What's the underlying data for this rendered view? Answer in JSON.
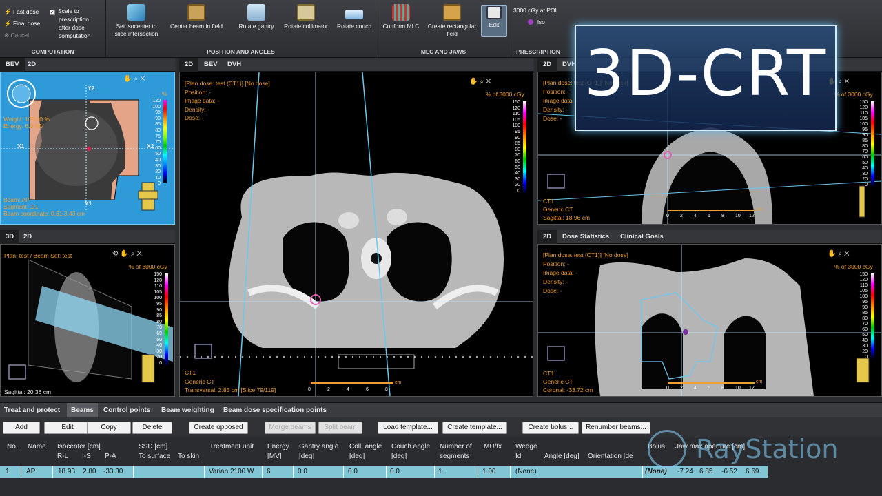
{
  "ribbon": {
    "computation": {
      "fast_dose": "Fast dose",
      "final_dose": "Final dose",
      "cancel": "Cancel",
      "scale_check": "Scale to",
      "scale_l2": "prescription",
      "scale_l3": "after dose",
      "scale_l4": "computation",
      "label": "COMPUTATION"
    },
    "position": {
      "set_iso_l1": "Set isocenter to",
      "set_iso_l2": "slice intersection",
      "center_beam": "Center beam in field",
      "rotate_gantry": "Rotate gantry",
      "rotate_collimator": "Rotate collimator",
      "rotate_couch": "Rotate couch",
      "label": "POSITION AND ANGLES"
    },
    "mlc": {
      "conform": "Conform MLC",
      "create_rect_l1": "Create rectangular",
      "create_rect_l2": "field",
      "edit": "Edit",
      "label": "MLC AND JAWS"
    },
    "prescription": {
      "value": "3000 cGy at POI",
      "iso": "iso",
      "label": "PRESCRIPTION"
    }
  },
  "title_overlay": "3D-CRT",
  "logo": "RayStation",
  "bev": {
    "tabs": [
      "BEV",
      "2D"
    ],
    "weight": "Weight: 100.00 %",
    "energy": "Energy: 6.0 MV",
    "y2": "Y2",
    "y1": "Y1",
    "x1": "X1",
    "x2": "X2",
    "beam": "Beam: AP",
    "segment": "Segment: 1/1",
    "beam_coord": "Beam coordinate: 0.61 3.43 cm",
    "scale_unit": "%",
    "scale": [
      "120",
      "100",
      "95",
      "90",
      "85",
      "80",
      "75",
      "70",
      "60",
      "50",
      "40",
      "30",
      "20",
      "10",
      "0"
    ]
  },
  "view3d": {
    "tabs": [
      "3D",
      "2D"
    ],
    "plan": "Plan: test / Beam Set: test",
    "unit": "% of 3000 cGy",
    "scale": [
      "150",
      "120",
      "110",
      "105",
      "100",
      "95",
      "90",
      "85",
      "80",
      "70",
      "60",
      "50",
      "40",
      "30",
      "20",
      "0"
    ],
    "sagittal": "Sagittal: 20.36 cm"
  },
  "center": {
    "tabs": [
      "2D",
      "BEV",
      "DVH"
    ],
    "plan_dose": "[Plan dose: test (CT1)] [No dose]",
    "position": "Position: -",
    "image_data": "Image data: -",
    "density": "Density: -",
    "dose": "Dose: -",
    "unit": "% of 3000 cGy",
    "scale": [
      "150",
      "120",
      "110",
      "105",
      "100",
      "95",
      "90",
      "85",
      "80",
      "70",
      "60",
      "50",
      "40",
      "30",
      "20",
      "0"
    ],
    "ct": "CT1",
    "generic": "Generic CT",
    "transversal": "Transversal: 2.85 cm [Slice 79/119]",
    "ruler": [
      "0",
      "2",
      "4",
      "6",
      "8"
    ],
    "ruler_unit": "cm"
  },
  "topright": {
    "tabs": [
      "2D",
      "DVH"
    ],
    "plan_dose": "[Plan dose: test (CT1)] [No dose]",
    "position": "Position: -",
    "image_data": "Image data: -",
    "density": "Density: -",
    "dose": "Dose: -",
    "unit": "% of 3000 cGy",
    "scale": [
      "150",
      "120",
      "110",
      "105",
      "100",
      "95",
      "90",
      "85",
      "80",
      "70",
      "60",
      "50",
      "40",
      "30",
      "20",
      "0"
    ],
    "ct": "CT1",
    "generic": "Generic CT",
    "sagittal": "Sagittal: 18.96 cm",
    "ruler": [
      "0",
      "2",
      "4",
      "6",
      "8",
      "10",
      "12"
    ],
    "ruler_unit": "cm"
  },
  "bottomright": {
    "tabs": [
      "2D",
      "Dose Statistics",
      "Clinical Goals"
    ],
    "plan_dose": "[Plan dose: test (CT1)] [No dose]",
    "position": "Position: -",
    "image_data": "Image data: -",
    "density": "Density: -",
    "dose": "Dose: -",
    "unit": "% of 3000 cGy",
    "scale": [
      "150",
      "120",
      "110",
      "105",
      "100",
      "95",
      "90",
      "85",
      "80",
      "70",
      "60",
      "50",
      "40",
      "30",
      "20",
      "0"
    ],
    "ct": "CT1",
    "generic": "Generic CT",
    "coronal": "Coronal: -33.72 cm",
    "ruler": [
      "0",
      "2",
      "4",
      "6",
      "8",
      "10",
      "12"
    ],
    "ruler_unit": "cm"
  },
  "bottom_tabs": [
    "Treat and protect",
    "Beams",
    "Control points",
    "Beam weighting",
    "Beam dose specification points"
  ],
  "buttons": [
    "Add",
    "Edit",
    "Copy",
    "Delete",
    "Create opposed",
    "Merge beams",
    "Split beam",
    "Load template...",
    "Create template...",
    "Create bolus...",
    "Renumber beams..."
  ],
  "table": {
    "headers": {
      "no": "No.",
      "name": "Name",
      "iso": "Isocenter [cm]",
      "rl": "R-L",
      "is": "I-S",
      "pa": "P-A",
      "ssd": "SSD [cm]",
      "to_surface": "To surface",
      "to_skin": "To skin",
      "unit": "Treatment unit",
      "energy": "Energy",
      "mv": "[MV]",
      "gantry": "Gantry angle",
      "coll": "Coll. angle",
      "couch": "Couch angle",
      "deg": "[deg]",
      "segments": "Number of",
      "segments2": "segments",
      "mufx": "MU/fx",
      "wedge": "Wedge",
      "wid": "Id",
      "wangle": "Angle [deg]",
      "orient": "Orientation [de",
      "bolus": "Bolus",
      "jaw": "Jaw max aperture [cm]"
    },
    "row": {
      "no": "1",
      "name": "AP",
      "rl": "18.93",
      "is": "2.80",
      "pa": "-33.30",
      "unit": "Varian 2100 W",
      "energy": "6",
      "gantry": "0.0",
      "coll": "0.0",
      "couch": "0.0",
      "segments": "1",
      "mufx": "1.00",
      "wedge": "(None)",
      "bolus": "(None)",
      "j1": "-7.24",
      "j2": "6.85",
      "j3": "-6.52",
      "j4": "6.69"
    }
  }
}
